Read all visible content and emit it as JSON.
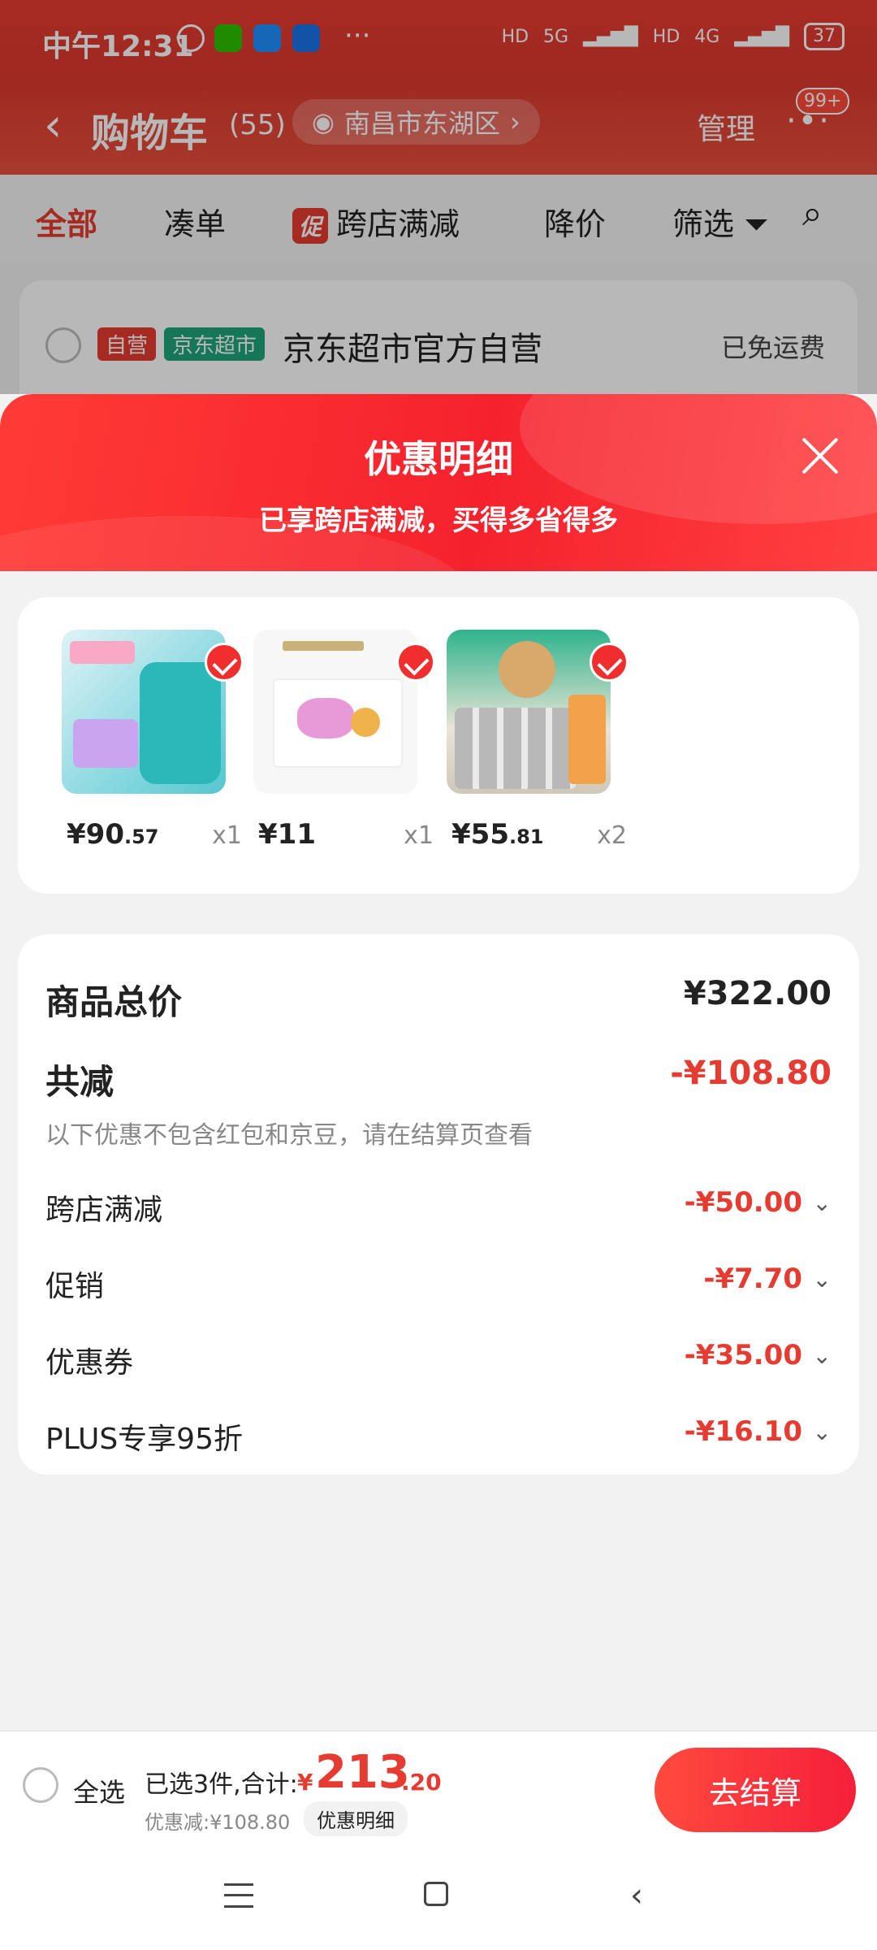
{
  "status_bar": {
    "time": "中午12:31",
    "net1": "5G",
    "net2": "4G",
    "battery": "37"
  },
  "header": {
    "title": "购物车",
    "count": "(55)",
    "location": "南昌市东湖区",
    "manage": "管理",
    "badge": "99+"
  },
  "filters": [
    {
      "label": "全部"
    },
    {
      "label": "凑单"
    },
    {
      "badge": "促",
      "label": "跨店满减"
    },
    {
      "label": "降价"
    },
    {
      "label": "筛选"
    }
  ],
  "store": {
    "tag_self": "自营",
    "tag_jd": "京东超市",
    "name": "京东超市官方自营",
    "shipping": "已免运费"
  },
  "sheet": {
    "title": "优惠明细",
    "subtitle": "已享跨店满减，买得多省得多"
  },
  "products": [
    {
      "price_int": "¥90",
      "price_dec": ".57",
      "qty": "x1"
    },
    {
      "price_int": "¥11",
      "price_dec": "",
      "qty": "x1"
    },
    {
      "price_int": "¥55",
      "price_dec": ".81",
      "qty": "x2"
    }
  ],
  "summary": {
    "total_label": "商品总价",
    "total_value": "¥322.00",
    "reduce_label": "共减",
    "reduce_value": "-¥108.80",
    "note": "以下优惠不包含红包和京豆，请在结算页查看",
    "items": [
      {
        "label": "跨店满减",
        "value": "-¥50.00"
      },
      {
        "label": "促销",
        "value": "-¥7.70"
      },
      {
        "label": "优惠券",
        "value": "-¥35.00"
      },
      {
        "label": "PLUS专享95折",
        "value": "-¥16.10"
      }
    ]
  },
  "bottom": {
    "select_all": "全选",
    "selected_info": "已选3件,合计:",
    "yen": "¥",
    "total_int": "213",
    "total_dec": ".20",
    "discount": "优惠减:¥108.80",
    "detail_btn": "优惠明细",
    "checkout": "去结算"
  },
  "colors": {
    "accent": "#e53b30",
    "header_red": "#de3a2f",
    "sheet_red": "#f5222d"
  }
}
